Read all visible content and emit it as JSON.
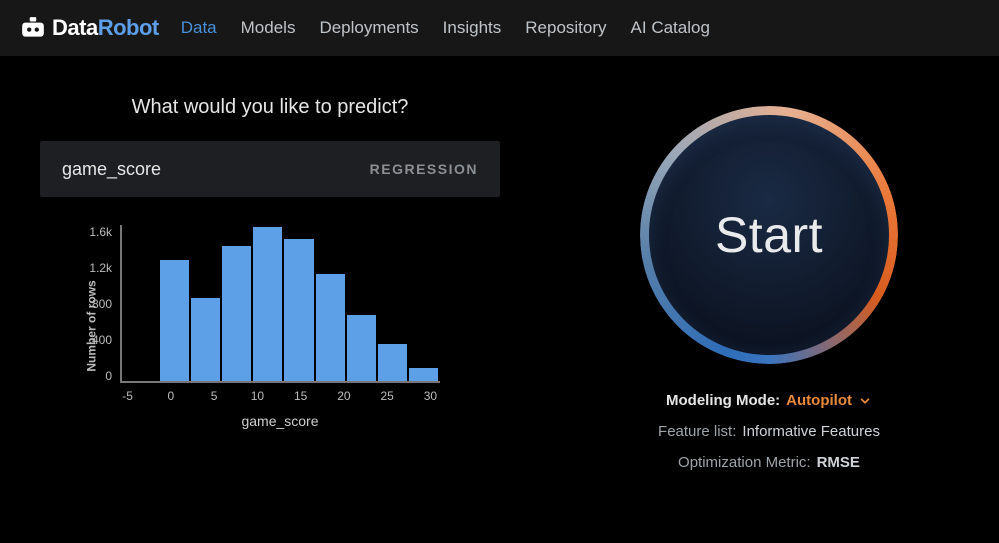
{
  "brand": {
    "part1": "Data",
    "part2": "Robot"
  },
  "nav": {
    "items": [
      "Data",
      "Models",
      "Deployments",
      "Insights",
      "Repository",
      "AI Catalog"
    ],
    "active_index": 0
  },
  "prompt": "What would you like to predict?",
  "target": {
    "name": "game_score",
    "type": "REGRESSION"
  },
  "start_label": "Start",
  "settings": {
    "mode_label": "Modeling Mode:",
    "mode_value": "Autopilot",
    "feature_list_label": "Feature list:",
    "feature_list_value": "Informative Features",
    "metric_label": "Optimization Metric:",
    "metric_value": "RMSE"
  },
  "chart_data": {
    "type": "bar",
    "title": "",
    "xlabel": "game_score",
    "ylabel": "Number of rows",
    "x_ticks": [
      -5,
      0,
      5,
      10,
      15,
      20,
      25,
      30
    ],
    "y_ticks": [
      "1.6k",
      "1.2k",
      "800",
      "400",
      "0"
    ],
    "ylim": [
      0,
      1800
    ],
    "categories": [
      "0",
      "5",
      "10",
      "15",
      "20",
      "25",
      "30"
    ],
    "values": [
      1400,
      960,
      1560,
      1780,
      1640,
      1240,
      760,
      430,
      150
    ],
    "note": "Histogram of game_score; bars span bins starting at 0 through 30 in steps of ~3-4, values approximate from pixel heights."
  }
}
